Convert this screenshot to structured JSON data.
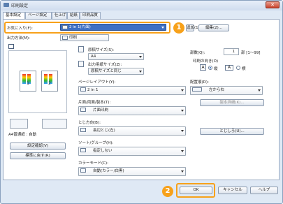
{
  "window": {
    "title": "印刷設定",
    "close": "✕"
  },
  "tabs": [
    "基本設定",
    "ページ設定",
    "仕上げ",
    "給紙",
    "印刷品質"
  ],
  "favorites": {
    "label": "お気に入り(F):",
    "value": "2 in 1(片面)",
    "add_button": "追加(1)...",
    "edit_button": "編集(2)..."
  },
  "output": {
    "label": "出力方法(M):",
    "value": "印刷"
  },
  "preview": {
    "page1": "1",
    "page2": "2",
    "status": "A4普通紙 : 自動",
    "settings_button": "設定確認(V)",
    "restore_button": "標準に戻す(R)"
  },
  "orig_size": {
    "label": "原稿サイズ(S):",
    "value": "A4"
  },
  "out_size": {
    "label": "出力用紙サイズ(Z):",
    "value": "原稿サイズと同じ"
  },
  "copies": {
    "label": "部数(Q):",
    "value": "1",
    "range": "部 [1〜99]"
  },
  "orientation": {
    "label": "印刷の向き(O)",
    "portrait": "縦",
    "landscape": "横",
    "portrait_icon": "A",
    "landscape_icon": "A"
  },
  "layout": {
    "label": "ページレイアウト(Y):",
    "value": "2 in 1"
  },
  "order": {
    "label": "配置順(D):",
    "value": "左から右"
  },
  "duplex": {
    "label": "片面/両面/製本(T):",
    "value": "片面印刷"
  },
  "booklet_button": "製本詳細(K)...",
  "binding": {
    "label": "とじ方向(B):",
    "value": "長辺とじ(左)",
    "margin_button": "とじしろ(U)..."
  },
  "sort": {
    "label": "ソート/グループ(H):",
    "value": "指定しない"
  },
  "color": {
    "label": "カラーモード(C):",
    "value": "自動(カラー/白黒)"
  },
  "footer": {
    "ok": "OK",
    "cancel": "キャンセル",
    "help": "ヘルプ"
  },
  "callouts": {
    "one": "1",
    "two": "2"
  },
  "colors": {
    "accent": "#f7a11a",
    "window_bg": "#dfe9f5"
  }
}
